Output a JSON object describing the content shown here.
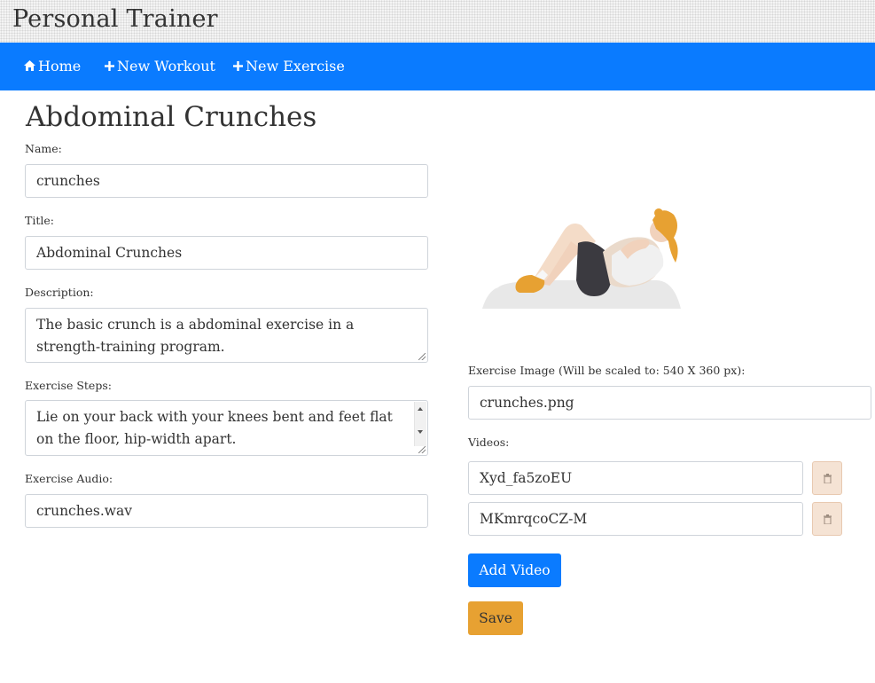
{
  "app": {
    "title": "Personal Trainer"
  },
  "nav": {
    "items": [
      {
        "label": "Home",
        "icon": "home-icon"
      },
      {
        "label": "New Workout",
        "icon": "plus-icon"
      },
      {
        "label": "New Exercise",
        "icon": "plus-icon"
      }
    ]
  },
  "page": {
    "heading": "Abdominal Crunches"
  },
  "form": {
    "name": {
      "label": "Name:",
      "value": "crunches"
    },
    "title": {
      "label": "Title:",
      "value": "Abdominal Crunches"
    },
    "description": {
      "label": "Description:",
      "value": "The basic crunch is a abdominal exercise in a strength-training program."
    },
    "steps": {
      "label": "Exercise Steps:",
      "value": "Lie on your back with your knees bent and feet flat on the floor, hip-width apart."
    },
    "audio": {
      "label": "Exercise Audio:",
      "value": "crunches.wav"
    },
    "image": {
      "label": "Exercise Image (Will be scaled to: 540 X 360 px):",
      "value": "crunches.png"
    },
    "videos": {
      "label": "Videos:",
      "items": [
        "Xyd_fa5zoEU",
        "MKmrqcoCZ-M"
      ]
    }
  },
  "buttons": {
    "add_video": "Add Video",
    "save": "Save"
  },
  "colors": {
    "nav_bg": "#0a7bff",
    "save_bg": "#e7a132",
    "trash_bg": "#f5e3d4"
  }
}
